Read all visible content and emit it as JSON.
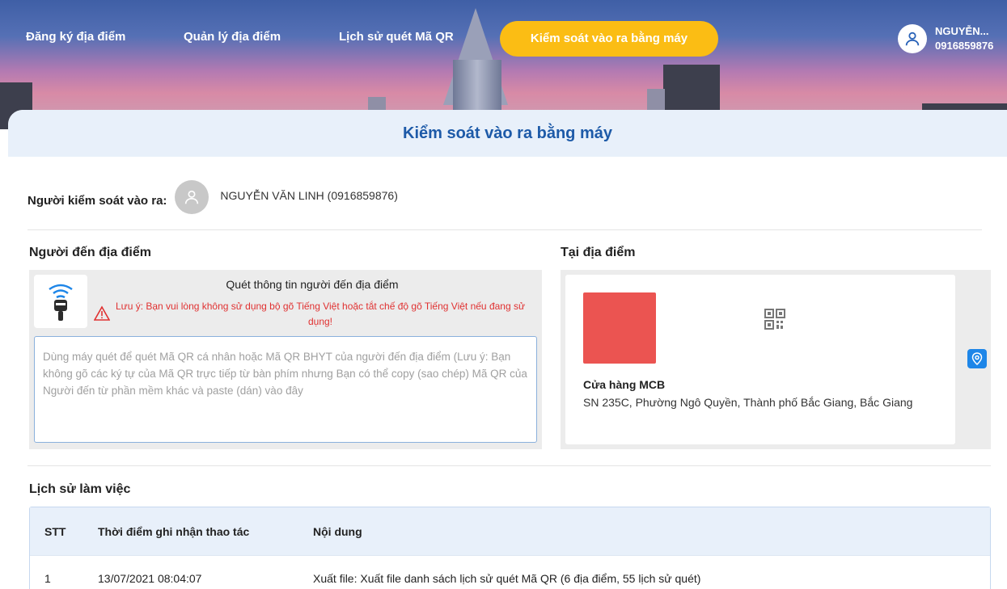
{
  "nav": {
    "items": [
      "Đăng ký địa điểm",
      "Quản lý địa điểm",
      "Lịch sử quét Mã QR"
    ],
    "active": "Kiểm soát vào ra bằng máy",
    "user_name": "NGUYỄN...",
    "user_phone": "0916859876"
  },
  "page": {
    "title": "Kiểm soát vào ra bằng máy",
    "controller_label": "Người kiểm soát vào ra:",
    "controller_name": "NGUYỄN VĂN LINH (0916859876)"
  },
  "visitor": {
    "section_title": "Người đến địa điểm",
    "scan_heading": "Quét thông tin người đến địa điểm",
    "warning": "Lưu ý: Bạn vui lòng không sử dụng bộ gõ Tiếng Việt hoặc tắt chế độ gõ Tiếng Việt nếu đang sử dụng!",
    "input_placeholder": "Dùng máy quét để quét Mã QR cá nhân hoặc Mã QR BHYT của người đến địa điểm (Lưu ý: Bạn không gõ các ký tự của Mã QR trực tiếp từ bàn phím nhưng Bạn có thể copy (sao chép) Mã QR của Người đến từ phần mềm khác và paste (dán) vào đây"
  },
  "location": {
    "section_title": "Tại địa điểm",
    "name": "Cửa hàng MCB",
    "address": "SN 235C, Phường Ngô Quyền, Thành phố Bắc Giang, Bắc Giang",
    "thumb_color": "#eb5451"
  },
  "history": {
    "section_title": "Lịch sử làm việc",
    "columns": [
      "STT",
      "Thời điểm ghi nhận thao tác",
      "Nội dung"
    ],
    "rows": [
      {
        "stt": "1",
        "time": "13/07/2021 08:04:07",
        "content": "Xuất file: Xuất file danh sách lịch sử quét Mã QR (6 địa điểm, 55 lịch sử quét)"
      }
    ]
  },
  "colors": {
    "accent": "#fbbd14",
    "title_blue": "#1d5aa8",
    "warning_red": "#e03131",
    "pin_blue": "#1e86e8"
  }
}
